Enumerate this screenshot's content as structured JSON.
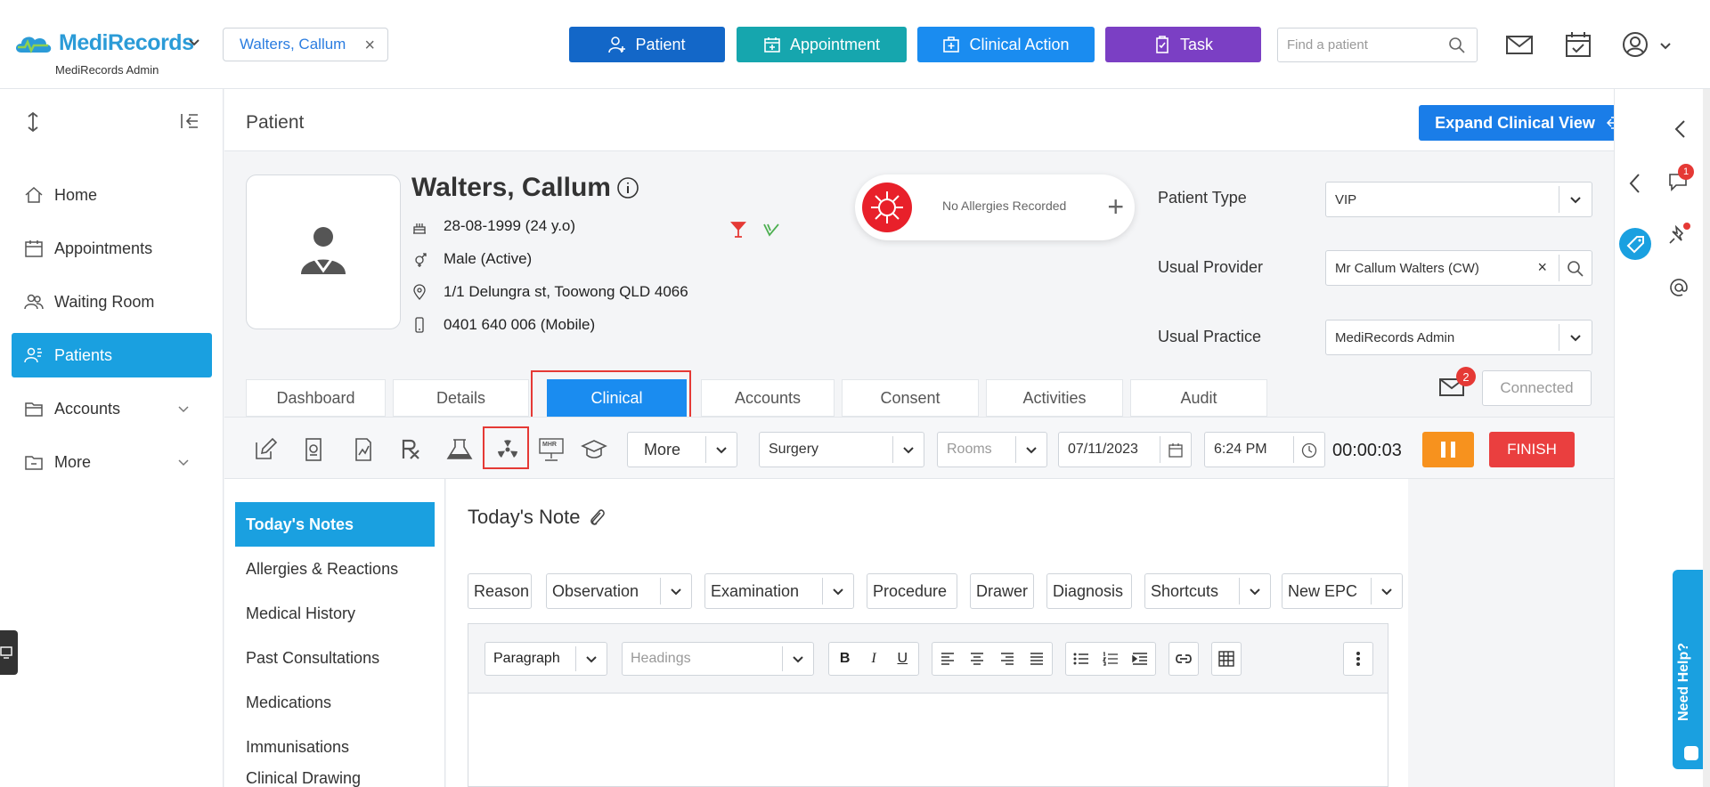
{
  "app": {
    "name": "MediRecords",
    "subtitle": "MediRecords Admin"
  },
  "header": {
    "patient_chip": "Walters, Callum",
    "buttons": {
      "patient": "Patient",
      "appointment": "Appointment",
      "clinical_action": "Clinical Action",
      "task": "Task"
    },
    "search_placeholder": "Find a patient"
  },
  "sidebar": {
    "items": [
      {
        "label": "Home",
        "icon": "home-icon"
      },
      {
        "label": "Appointments",
        "icon": "calendar-icon"
      },
      {
        "label": "Waiting Room",
        "icon": "people-icon"
      },
      {
        "label": "Patients",
        "icon": "patients-icon",
        "active": true
      },
      {
        "label": "Accounts",
        "icon": "folder-icon"
      },
      {
        "label": "More",
        "icon": "folder-icon"
      }
    ]
  },
  "page": {
    "title": "Patient",
    "expand_label": "Expand Clinical View"
  },
  "patient": {
    "name": "Walters, Callum",
    "dob": "28-08-1999 (24 y.o)",
    "gender": "Male (Active)",
    "address": "1/1 Delungra st, Toowong QLD 4066",
    "phone": "0401 640 006 (Mobile)",
    "allergies": "No Allergies Recorded"
  },
  "fields": {
    "patient_type_label": "Patient Type",
    "patient_type_value": "VIP",
    "usual_provider_label": "Usual Provider",
    "usual_provider_value": "Mr Callum Walters (CW)",
    "usual_practice_label": "Usual Practice",
    "usual_practice_value": "MediRecords Admin"
  },
  "tabs": [
    "Dashboard",
    "Details",
    "Clinical",
    "Accounts",
    "Consent",
    "Activities",
    "Audit"
  ],
  "mail_badge": "2",
  "connected": "Connected",
  "toolbar": {
    "more": "More",
    "location": "Surgery",
    "rooms": "Rooms",
    "date": "07/11/2023",
    "time": "6:24 PM",
    "timer": "00:00:03",
    "finish": "FINISH",
    "mhr": "MHR"
  },
  "notes_nav": [
    "Today's Notes",
    "Allergies & Reactions",
    "Medical History",
    "Past Consultations",
    "Medications",
    "Immunisations",
    "Clinical Drawing"
  ],
  "note": {
    "title": "Today's Note",
    "chips": [
      "Reason",
      "Observation",
      "Examination",
      "Procedure",
      "Drawer",
      "Diagnosis",
      "Shortcuts",
      "New EPC"
    ],
    "paragraph": "Paragraph",
    "headings": "Headings"
  },
  "rail": {
    "badge": "1",
    "need_help": "Need Help?"
  },
  "colors": {
    "primary": "#1a8cf0",
    "active": "#1aa0e0",
    "danger": "#e53935"
  }
}
